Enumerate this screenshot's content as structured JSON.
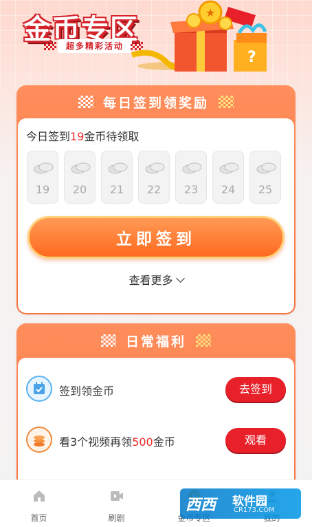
{
  "header": {
    "title": "金币专区",
    "subtitle": "超多精彩活动"
  },
  "sign_card": {
    "title": "每日签到领奖励",
    "status_prefix": "今日签到",
    "status_amount": "19",
    "status_suffix": "金币待领取",
    "days": [
      "19",
      "20",
      "21",
      "22",
      "23",
      "24",
      "25"
    ],
    "sign_button": "立即签到",
    "more_label": "查看更多"
  },
  "daily_card": {
    "title": "日常福利",
    "tasks": [
      {
        "label": "签到领金币",
        "action": "去签到",
        "icon": "calendar-icon"
      },
      {
        "label_prefix": "看3个视频再领",
        "label_amount": "500",
        "label_suffix": "金币",
        "action": "观看",
        "icon": "coin-stack-icon"
      }
    ]
  },
  "tabbar": {
    "tabs": [
      {
        "label": "首页",
        "icon": "home-icon"
      },
      {
        "label": "刷剧",
        "icon": "video-icon"
      },
      {
        "label": "金币专区",
        "icon": "coin-icon"
      },
      {
        "label": "我的",
        "icon": "profile-icon"
      }
    ]
  },
  "watermark": {
    "logo": "西西",
    "name": "软件园",
    "domain": "CR173.COM"
  },
  "colors": {
    "accent": "#f7743f",
    "brand_red": "#e8202a",
    "highlight": "#ee2a2a"
  }
}
